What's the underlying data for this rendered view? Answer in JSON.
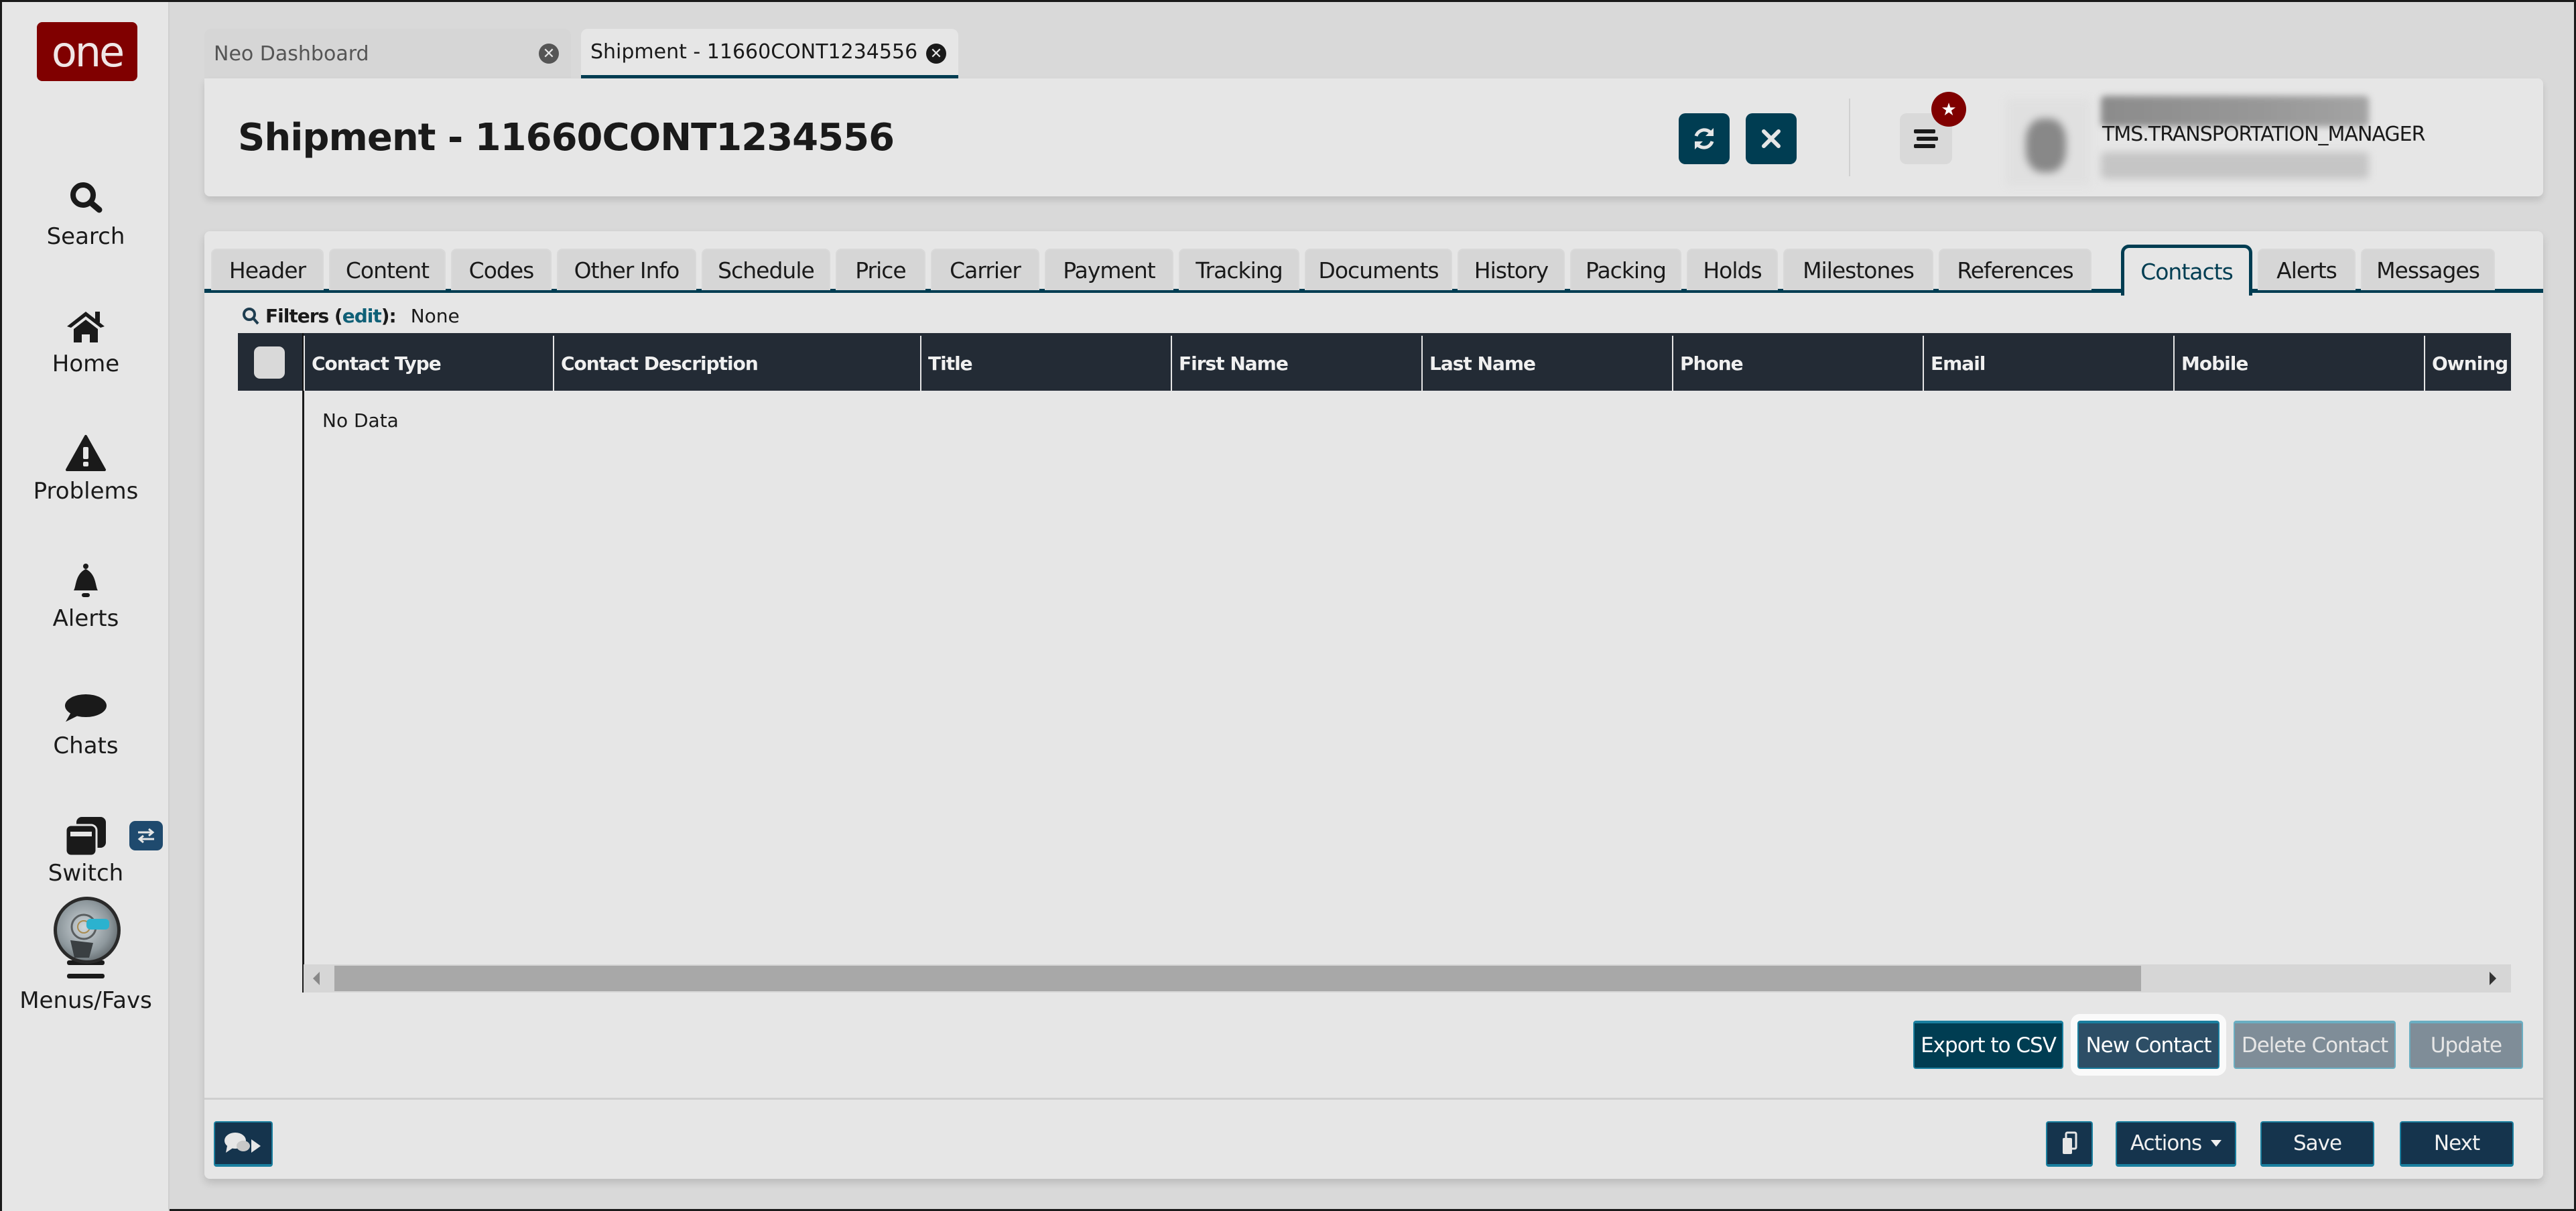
{
  "app": {
    "logo_text": "one",
    "brand_color": "#800000",
    "accent_color": "#003d52"
  },
  "sidebar": {
    "items": [
      {
        "label": "Search",
        "icon": "search-icon"
      },
      {
        "label": "Home",
        "icon": "home-icon"
      },
      {
        "label": "Problems",
        "icon": "warning-icon"
      },
      {
        "label": "Alerts",
        "icon": "bell-icon"
      },
      {
        "label": "Chats",
        "icon": "chat-icon"
      },
      {
        "label": "Switch",
        "icon": "switch-windows-icon"
      },
      {
        "label": "Menus/Favs",
        "icon": "hamburger-icon"
      }
    ],
    "switch_badge_icon": "swap-arrows-icon",
    "assistant_avatar_icon": "ai-assistant-avatar"
  },
  "doc_tabs": [
    {
      "label": "Neo Dashboard",
      "active": false
    },
    {
      "label": "Shipment - 11660CONT1234556",
      "active": true
    }
  ],
  "header": {
    "title": "Shipment - 11660CONT1234556",
    "refresh_icon": "refresh-icon",
    "close_icon": "close-icon",
    "menu_icon": "hamburger-icon",
    "favorite_badge_icon": "star-icon",
    "user_role": "TMS.TRANSPORTATION_MANAGER",
    "dropdown_icon": "chevron-down-icon",
    "dropdown_glyph": "⌄"
  },
  "section_tabs": [
    {
      "label": "Header"
    },
    {
      "label": "Content"
    },
    {
      "label": "Codes"
    },
    {
      "label": "Other Info"
    },
    {
      "label": "Schedule"
    },
    {
      "label": "Price"
    },
    {
      "label": "Carrier"
    },
    {
      "label": "Payment"
    },
    {
      "label": "Tracking"
    },
    {
      "label": "Documents"
    },
    {
      "label": "History"
    },
    {
      "label": "Packing"
    },
    {
      "label": "Holds"
    },
    {
      "label": "Milestones"
    },
    {
      "label": "References"
    },
    {
      "label": "Contacts",
      "active": true
    },
    {
      "label": "Alerts"
    },
    {
      "label": "Messages"
    }
  ],
  "filters": {
    "label": "Filters (",
    "edit_label": "edit",
    "suffix": "):",
    "value": "None"
  },
  "grid": {
    "columns": [
      "Contact Type",
      "Contact Description",
      "Title",
      "First Name",
      "Last Name",
      "Phone",
      "Email",
      "Mobile",
      "Owning"
    ],
    "rows": [],
    "empty_text": "No Data",
    "horizontal_scroll_position": 0
  },
  "grid_actions": {
    "export_label": "Export to CSV",
    "new_label": "New Contact",
    "delete_label": "Delete Contact",
    "update_label": "Update"
  },
  "footer": {
    "chat_icon": "chat-send-icon",
    "copy_icon": "copy-icon",
    "actions_label": "Actions",
    "save_label": "Save",
    "next_label": "Next"
  }
}
